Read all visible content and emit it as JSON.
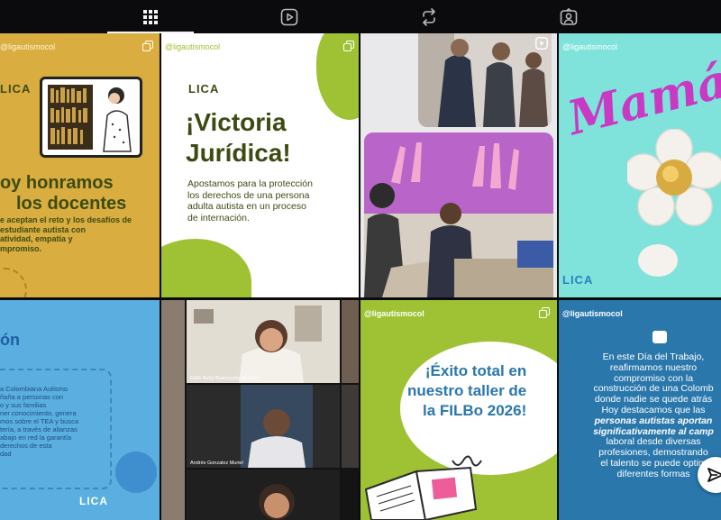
{
  "tabs": [
    {
      "name": "posts",
      "icon": "grid-icon"
    },
    {
      "name": "reels",
      "icon": "reels-icon"
    },
    {
      "name": "reposts",
      "icon": "repost-icon"
    },
    {
      "name": "tagged",
      "icon": "tagged-icon"
    }
  ],
  "colors": {
    "bg": "#0b0b0d",
    "mustard": "#d9ad3f",
    "olive": "#3d4b12",
    "lime": "#9ec234",
    "blue": "#2f7ec7",
    "lightblue": "#5aaee0",
    "aqua": "#7fe3dc",
    "pink": "#c939c4",
    "teal": "#2a77ac"
  },
  "posts": {
    "p1": {
      "handle": "@ligautismocol",
      "logo": "LICA",
      "headline_1": "oy honramos",
      "headline_2": "los docentes",
      "body": [
        "e aceptan el reto y los desafíos de",
        "estudiante autista con",
        "atividad, empatía y",
        "mpromiso."
      ]
    },
    "p2": {
      "handle": "@ligautismocol",
      "logo": "LICA",
      "title_1": "¡Victoria",
      "title_2": "Jurídica!",
      "body": [
        "Apostamos para la protección",
        "los derechos de una persona",
        "adulta autista en un proceso",
        "de internación."
      ]
    },
    "p3": {
      "type": "video"
    },
    "p4": {
      "handle": "@ligautismocol",
      "script": "Mamá",
      "logo": "LICA"
    },
    "p5": {
      "title": "ón",
      "body": [
        "a Colombiana Autismo",
        "ñaña a personas con",
        "o y sus familias",
        "ner conocimiento, genera",
        "mos sobre el TEA y busca",
        "tería, a través de alianzas",
        "abajo en red la garantía",
        "derechos de esta",
        "dad"
      ],
      "logo": "LICA"
    },
    "p6": {
      "people": [
        "Edith Betty Buenavista Morales",
        "Andrés Gonzalez Muriel"
      ]
    },
    "p7": {
      "handle": "@ligautismocol",
      "lines": [
        "¡Éxito total en",
        "nuestro taller de",
        "la FILBo 2026!"
      ]
    },
    "p8": {
      "handle": "@ligautismocol",
      "lines": [
        "En este Día del Trabajo,",
        "reafirmamos nuestro",
        "compromiso con la",
        "construcción de una Colomb",
        "donde nadie se quede atrás",
        "Hoy destacamos que las",
        "personas autistas aportan",
        "significativamente al camp",
        "laboral desde diversas",
        "profesiones, demostrando",
        "el talento se puede optim",
        "diferentes formas"
      ]
    }
  }
}
